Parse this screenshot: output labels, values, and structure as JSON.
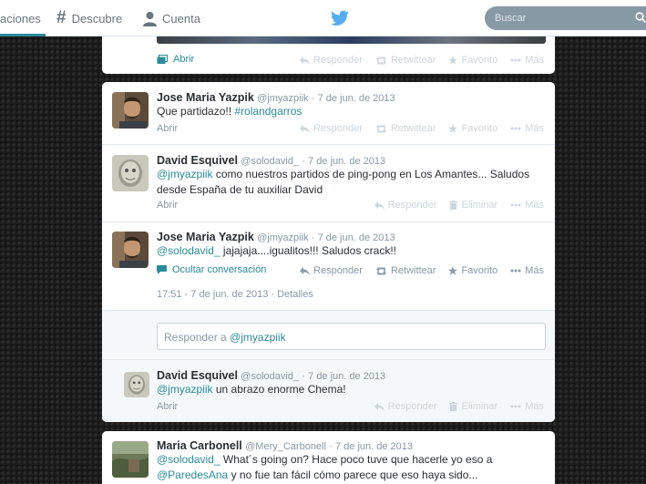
{
  "nav": {
    "notifications_label": "aciones",
    "discover_label": "Descubre",
    "account_label": "Cuenta",
    "search_placeholder": "Buscar"
  },
  "colors": {
    "accent": "#2a8a9a",
    "twitter_blue": "#55acee",
    "muted": "#8899a6"
  },
  "actions": {
    "reply": "Responder",
    "retweet": "Retwittear",
    "favorite": "Favorito",
    "more": "Más",
    "delete": "Eliminar",
    "open": "Abrir",
    "hide_conversation": "Ocultar conversación"
  },
  "top_card": {
    "open_label": "Abrir"
  },
  "conversation": {
    "tweet1": {
      "fullname": "Jose Maria Yazpik",
      "handle": "@jmyazpiik",
      "date": "· 7 de jun. de 2013",
      "text": "Que partidazo!! ",
      "hashtag": "#rolandgarros"
    },
    "tweet2": {
      "fullname": "David Esquivel",
      "handle": "@solodavid_",
      "date": "· 7 de jun. de 2013",
      "mention": "@jmyazpiik",
      "text": " como nuestros partidos de ping-pong en Los Amantes... Saludos desde España de tu auxiliar David"
    },
    "tweet3": {
      "fullname": "Jose Maria Yazpik",
      "handle": "@jmyazpiik",
      "date": "· 7 de jun. de 2013",
      "mention": "@solodavid_",
      "text": " jajajaja....igualitos!!! Saludos crack!!",
      "detail_time": "17:51 - 7 de jun. de 2013",
      "detail_link": " · Detalles"
    },
    "reply_prompt": "Responder a ",
    "reply_mention": "@jmyazpiik",
    "tweet4": {
      "fullname": "David Esquivel",
      "handle": "@solodavid_",
      "date": "· 7 de jun. de 2013",
      "mention": "@jmyazpiik",
      "text": " un abrazo enorme Chema!"
    }
  },
  "bottom_card": {
    "fullname": "Maria Carbonell",
    "handle": "@Mery_Carbonell",
    "date": "· 7 de jun. de 2013",
    "mention1": "@solodavid_",
    "text1": " What´s going on? Hace poco tuve que hacerle yo eso a",
    "mention2": "@ParedesAna",
    "text2": " y no fue tan fácil cómo parece que eso haya sido..."
  }
}
